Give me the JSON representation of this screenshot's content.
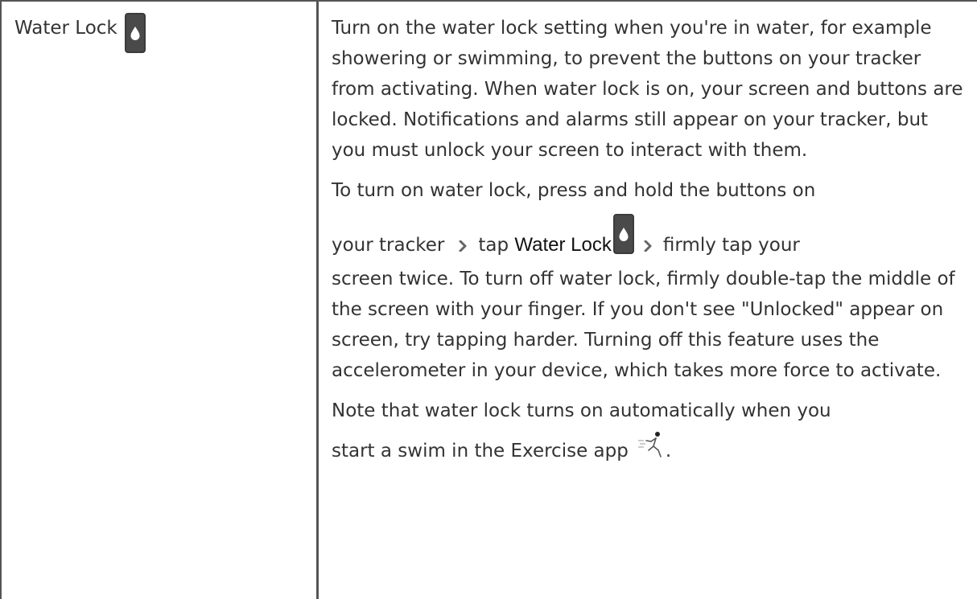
{
  "row": {
    "setting_name": "Water Lock",
    "paragraph_1": "Turn on the water lock setting when you're in water, for example showering or swimming, to prevent the buttons on your tracker from activating. When water lock is on, your screen and buttons are locked. Notifications and alarms still appear on your tracker, but you must unlock your screen to interact with them.",
    "paragraph_2": {
      "line_1": "To turn on water lock, press and hold the buttons on",
      "seg_1": "your tracker",
      "seg_2": "tap ",
      "seg_3_bold": "Water Lock",
      "seg_4": "firmly tap your",
      "rest": "screen twice. To turn off water lock, firmly double-tap the middle of the screen with your finger. If you don't see \"Unlocked\" appear on screen, try tapping harder. Turning off this feature uses the accelerometer in your device, which takes more force to activate."
    },
    "paragraph_3": {
      "line_1": "Note that water lock turns on automatically when you",
      "line_2": "start a swim in the Exercise app",
      "end": "."
    }
  },
  "icons": {
    "water_drop": "water-drop-icon",
    "chevron": "chevron-right-icon",
    "exercise": "running-person-icon"
  },
  "colors": {
    "border": "#555555",
    "text": "#333333",
    "icon_bg": "#4a4a4a",
    "icon_drop": "#ffffff",
    "chevron": "#666666"
  }
}
